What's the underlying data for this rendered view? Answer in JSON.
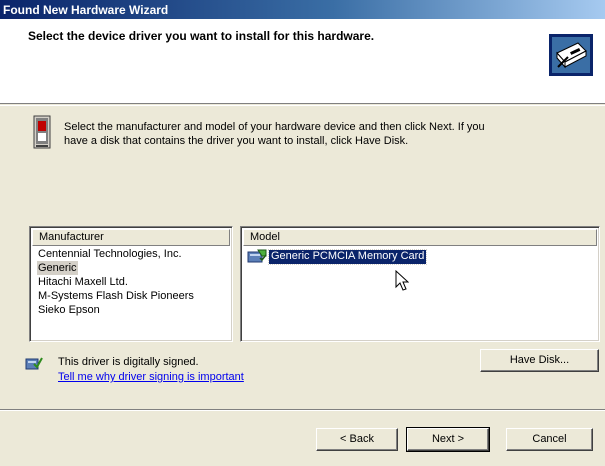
{
  "window": {
    "title": "Found New Hardware Wizard"
  },
  "header": {
    "title": "Select the device driver you want to install for this hardware."
  },
  "intro": {
    "line1": "Select the manufacturer and model of your hardware device and then click Next. If you",
    "line2": "have a disk that contains the driver you want to install, click Have Disk."
  },
  "manufacturer": {
    "header": "Manufacturer",
    "items": [
      "Centennial Technologies, Inc.",
      "Generic",
      "Hitachi Maxell Ltd.",
      "M-Systems Flash Disk Pioneers",
      "Sieko Epson"
    ],
    "selected": "Generic"
  },
  "model": {
    "header": "Model",
    "items": [
      "Generic PCMCIA Memory Card"
    ],
    "selected": "Generic PCMCIA Memory Card"
  },
  "signing": {
    "status": "This driver is digitally signed.",
    "link": "Tell me why driver signing is important"
  },
  "buttons": {
    "have_disk": "Have Disk...",
    "back": "< Back",
    "next": "Next >",
    "cancel": "Cancel"
  },
  "colors": {
    "selection": "#0a246a",
    "dialog_bg": "#ece9d8",
    "link": "#0000ee"
  },
  "icons": {
    "header": "hardware-wizard-icon",
    "intro": "device-card-icon",
    "model": "driver-card-icon",
    "signed": "signed-driver-icon",
    "cursor": "mouse-pointer-icon"
  }
}
